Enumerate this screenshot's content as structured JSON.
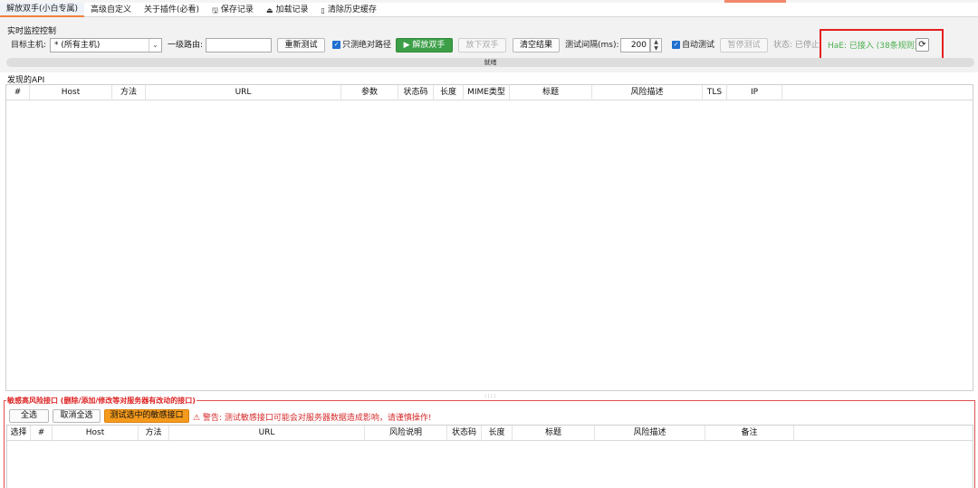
{
  "tabs": [
    {
      "label": "解放双手(小白专属)",
      "icon": ""
    },
    {
      "label": "高级自定义",
      "icon": ""
    },
    {
      "label": "关于插件(必看)",
      "icon": ""
    },
    {
      "label": "保存记录",
      "icon": "save-icon"
    },
    {
      "label": "加载记录",
      "icon": "folder-open-icon"
    },
    {
      "label": "清除历史缓存",
      "icon": "trash-icon"
    }
  ],
  "monitor": {
    "title": "实时监控控制",
    "target_host_label": "目标主机:",
    "target_host_value": "* (所有主机)",
    "route_label": "一级路由:",
    "route_value": "",
    "retest_button": "重新测试",
    "absolute_path_label": "只测绝对路径",
    "start_button": "▶ 解放双手",
    "stop_button": "放下双手",
    "clear_button": "清空结果",
    "interval_label": "测试间隔(ms):",
    "interval_value": "200",
    "auto_test_label": "自动测试",
    "pause_button": "暂停测试",
    "status_text": "状态: 已停止",
    "hae_status": "HaE: 已接入 (38条规则)",
    "progress_text": "就绪",
    "progress_value": 0
  },
  "api_table": {
    "label": "发现的API",
    "columns": [
      "#",
      "Host",
      "方法",
      "URL",
      "参数",
      "状态码",
      "长度",
      "MIME类型",
      "标题",
      "风险描述",
      "TLS",
      "IP"
    ]
  },
  "sensitive": {
    "title": "敏感高风险接口 (删除/添加/修改等对服务器有改动的接口)",
    "select_all": "全选",
    "deselect_all": "取消全选",
    "test_selected": "测试选中的敏感接口",
    "warning": "⚠ 警告: 测试敏感接口可能会对服务器数据造成影响，请谨慎操作!",
    "columns": [
      "选择",
      "#",
      "Host",
      "方法",
      "URL",
      "风险说明",
      "状态码",
      "长度",
      "标题",
      "风险描述",
      "备注"
    ]
  },
  "colors": {
    "accent_tab": "#f0823c",
    "start_button": "#3c9f48",
    "hae_text": "#4caf50",
    "highlight_box": "#e32020",
    "danger": "#d62b2b",
    "test_selected_button": "#f59a1c"
  }
}
